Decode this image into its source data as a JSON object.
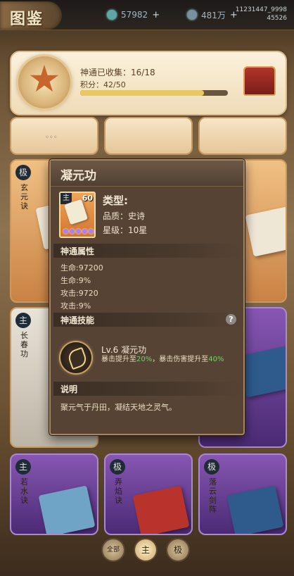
{
  "page_title": "图鉴",
  "topbar": {
    "currency1": {
      "icon": "jade-icon",
      "value": "57982",
      "plus": "+"
    },
    "currency2": {
      "icon": "silver-icon",
      "value": "481万",
      "plus": "+"
    },
    "account_id": "11231447_9998",
    "server_id": "45526"
  },
  "collection": {
    "collected_label": "神通已收集：16/18",
    "score_label": "积分：42/50",
    "score_progress": 0.84
  },
  "cards": [
    {
      "tag": "",
      "name": ""
    },
    {
      "tag": "",
      "name": ""
    },
    {
      "tag": "",
      "name": ""
    },
    {
      "tag": "极",
      "name": "玄元诀"
    },
    {
      "tag": "",
      "name": ""
    },
    {
      "tag": "主",
      "name": "长春功"
    },
    {
      "tag": "",
      "name": ""
    },
    {
      "tag": "主",
      "name": "若水诀"
    },
    {
      "tag": "极",
      "name": "弄焰诀"
    },
    {
      "tag": "极",
      "name": "落云剑阵"
    }
  ],
  "modal": {
    "title": "凝元功",
    "item": {
      "tag": "主",
      "level": "60"
    },
    "type_label": "类型:",
    "quality_label": "品质：史诗",
    "star_label": "星级：10星",
    "attr_section": "神通属性",
    "stats": [
      "生命:97200",
      "生命:9%",
      "攻击:9720",
      "攻击:9%"
    ],
    "skill_section": "神通技能",
    "help": "?",
    "skill_name": "Lv.6 凝元功",
    "skill_desc_1": "暴击提升至",
    "skill_desc_v1": "20%",
    "skill_desc_2": "，暴击伤害提升至",
    "skill_desc_v2": "40%",
    "desc_section": "说明",
    "desc_text": "聚元气于丹田，凝结天地之灵气。"
  },
  "filters": {
    "all": "全部",
    "zhu": "主",
    "ji": "极"
  }
}
